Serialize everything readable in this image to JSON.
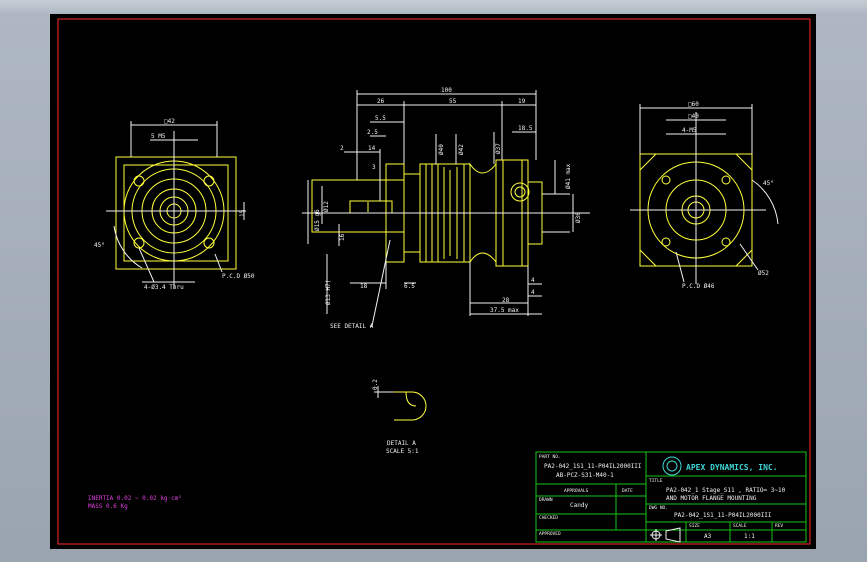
{
  "front_view": {
    "square_dim": "□42",
    "m_thread": "5 M5",
    "side_dim": "15",
    "angle": "45°",
    "holes": "4-Ø3.4 Thru",
    "pcd": "P.C.D Ø50"
  },
  "side_view": {
    "overall": "100",
    "d26": "26",
    "d55": "55",
    "d19": "19",
    "d5_5": "5.5",
    "d2_5": "2.5",
    "d2": "2",
    "d14": "14",
    "d3": "3",
    "d18_5": "18.5",
    "d40": "Ø40",
    "d42": "Ø42",
    "d37": "Ø37",
    "d41_max": "Ø41 max",
    "d30": "Ø30",
    "shaft_dia": "Ø15 g6",
    "d12": "Ø12",
    "d16": "16",
    "d13_h7": "Ø13 H7(",
    "d18": "18",
    "d6_5": "6.5",
    "d28": "28",
    "d4": "4",
    "d37_5": "37.5 max",
    "see_detail": "SEE DETAIL A"
  },
  "rear_view": {
    "square_dim": "□60",
    "sq40": "□40",
    "holes": "4-M5",
    "angle": "45°",
    "d52": "Ø52",
    "pcd": "P.C.D Ø46"
  },
  "detail": {
    "dim": "0.2",
    "label": "DETAIL A",
    "scale": "SCALE 5:1"
  },
  "notes": {
    "inertia": "INERTIA 0.02 ~ 0.02 kg·cm²",
    "mass": "MASS 0.6  Kg"
  },
  "title_block": {
    "part_no_label": "PART NO.",
    "part_no_1": "PA2-042_1S1_11-P04IL2000III",
    "part_no_2": "AB-PCZ-S31-M40-1",
    "company": "APEX DYNAMICS, INC.",
    "approvals": "APPROVALS",
    "date": "DATE",
    "title_label": "TITLE",
    "title_1": "PA2-042_1 Stage_S11 , RATIO= 3~10",
    "title_2": "AND MOTOR FLANGE MOUNTING",
    "drawn_label": "DRAWN",
    "drawn_by": "Candy",
    "checked_label": "CHECKED",
    "dwg_no_label": "DWG NO.",
    "dwg_no": "PA2-042_1S1_11-P04IL2000III",
    "approved_label": "APPROVED",
    "size_label": "SIZE",
    "size": "A3",
    "scale_label": "SCALE",
    "scale": "1:1",
    "rev_label": "REV"
  },
  "colors": {
    "background": "#000000",
    "outline": "#ffff3a",
    "dimension": "#f2f2f2",
    "border": "#ff2a2a",
    "title_block": "#19c419"
  }
}
